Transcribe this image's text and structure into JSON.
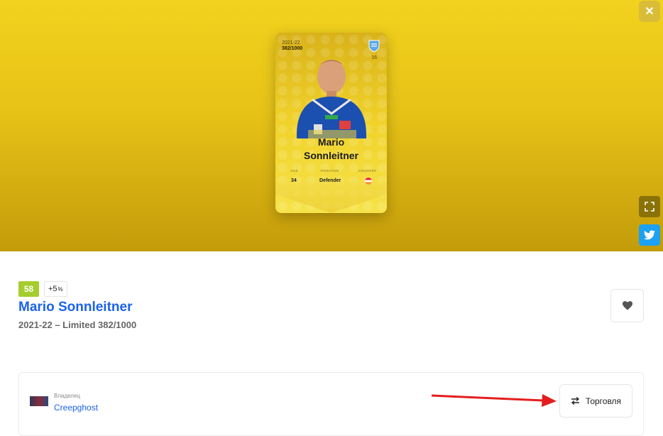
{
  "hero": {
    "close_icon": "close-icon",
    "fullscreen_icon": "fullscreen-icon",
    "twitter_icon": "twitter-icon",
    "card": {
      "season": "2021-22",
      "serial": "382/1000",
      "club_icon": "club-crest-icon",
      "number": "16",
      "first_name": "Mario",
      "last_name": "Sonnleitner",
      "stats": {
        "age_label": "AGE",
        "age_value": "34",
        "position_label": "POSITION",
        "position_value": "Defender",
        "country_label": "COUNTRY",
        "country_flag": "austria-flag-icon"
      }
    }
  },
  "details": {
    "score": "58",
    "bonus": "+5",
    "bonus_unit": "%",
    "player_name": "Mario Sonnleitner",
    "subtitle": "2021-22 – Limited 382/1000",
    "like_icon": "heart-icon"
  },
  "owner": {
    "label": "Владелец",
    "name": "Creepghost",
    "trade_label": "Торговля",
    "trade_icon": "swap-arrows-icon"
  },
  "colors": {
    "hero_top": "#f2d21e",
    "hero_bottom": "#c39c0a",
    "link_blue": "#1a63e8",
    "score_green": "#a6cd2e",
    "annotation_red": "#e41e1e"
  }
}
